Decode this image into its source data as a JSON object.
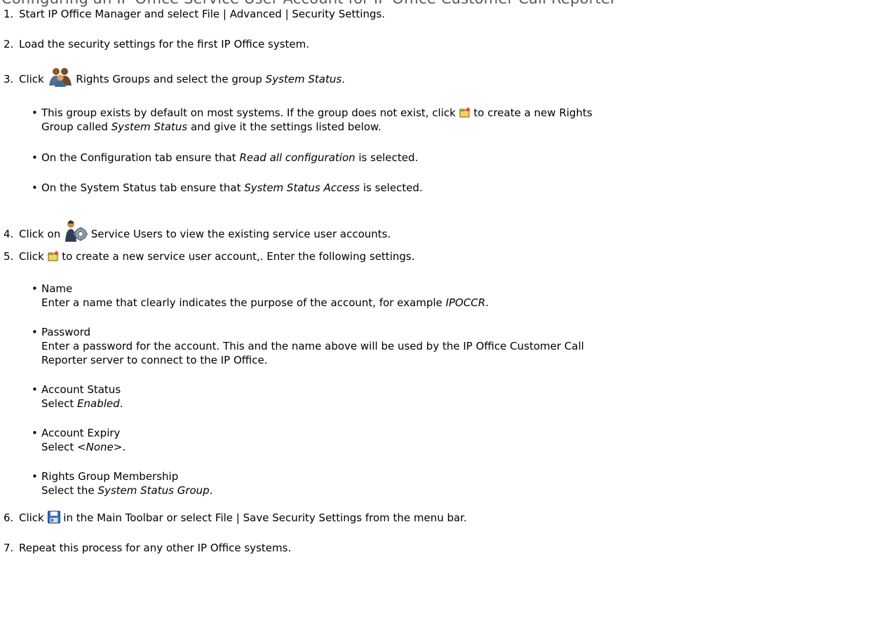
{
  "heading_partial": "Configuring an IP Office Service User Account for IP Office Customer Call Reporter",
  "steps": [
    {
      "num": "1.",
      "text": "Start IP Office Manager and select File | Advanced | Security Settings."
    },
    {
      "num": "2.",
      "text": "Load the security settings for the first IP Office system."
    },
    {
      "num": "3.",
      "pre": "Click ",
      "post": " Rights Groups and select the group ",
      "em": "System Status",
      "end": "."
    },
    {
      "num": "4.",
      "pre": "Click on ",
      "post": " Service Users to view the existing service user accounts."
    },
    {
      "num": "5.",
      "pre": "Click ",
      "post": " to create a new service user account,. Enter the following settings."
    },
    {
      "num": "6.",
      "pre": "Click ",
      "post": " in the Main Toolbar or select File | Save Security Settings from the menu bar."
    },
    {
      "num": "7.",
      "text": "Repeat this process for any other IP Office systems."
    }
  ],
  "step3_bullets": {
    "b1_a": "This group exists by default on most systems. If the group does not exist, click ",
    "b1_b": " to create a new Rights",
    "b1_c": "Group called ",
    "b1_em": "System Status",
    "b1_d": " and give it the settings listed below.",
    "b2_a": "On the Configuration tab ensure that ",
    "b2_em": "Read all configuration",
    "b2_b": " is selected.",
    "b3_a": "On the System Status tab ensure that ",
    "b3_em": "System Status Access",
    "b3_b": " is selected."
  },
  "settings": [
    {
      "title": "Name",
      "pre": "Enter a name that clearly indicates the purpose of the account, for example ",
      "em": "IPOCCR",
      "post": "."
    },
    {
      "title": "Password",
      "line1": "Enter a password for the account. This and the name above will be used by the IP Office Customer Call",
      "line2": "Reporter server to connect to the IP Office."
    },
    {
      "title": "Account Status",
      "pre": "Select ",
      "em": "Enabled",
      "post": "."
    },
    {
      "title": "Account Expiry",
      "pre": "Select ",
      "em": "<None>",
      "post": "."
    },
    {
      "title": "Rights Group Membership",
      "pre": "Select the ",
      "em": "System Status Group",
      "post": "."
    }
  ],
  "icons": {
    "rights_groups": "rights-groups-icon",
    "service_users": "service-users-icon",
    "new_item": "new-item-icon",
    "save": "save-icon"
  }
}
